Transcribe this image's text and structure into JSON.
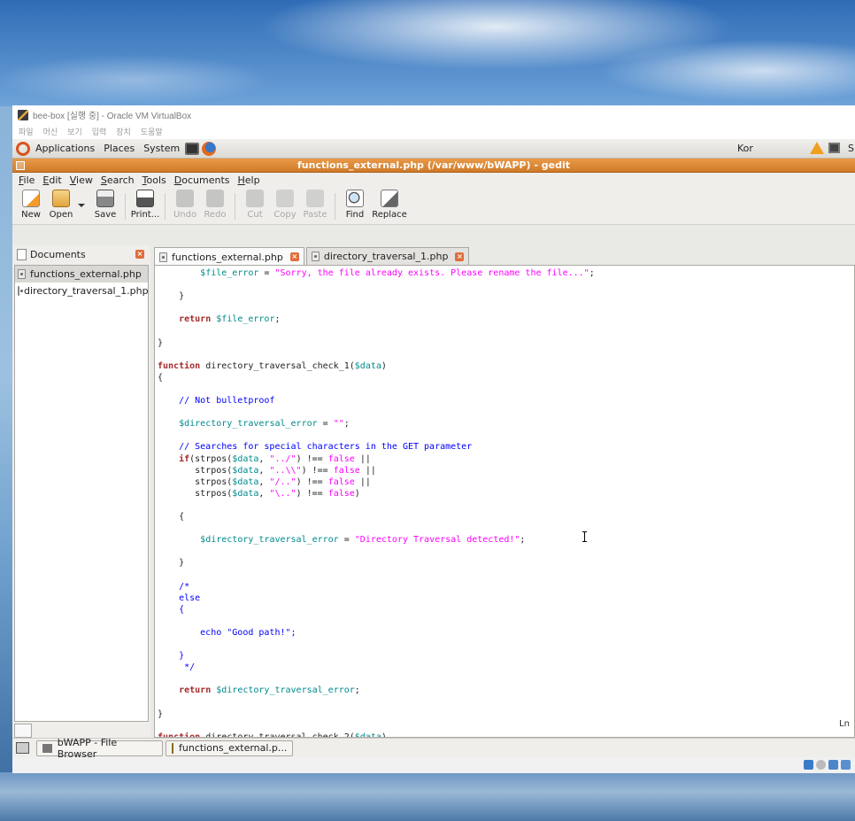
{
  "vbox": {
    "title": "bee-box [실행 중] - Oracle VM VirtualBox",
    "menu": [
      "파일",
      "머신",
      "보기",
      "입력",
      "장치",
      "도움말"
    ]
  },
  "gnome_panel": {
    "items": [
      "Applications",
      "Places",
      "System"
    ],
    "keyboard": "Kor",
    "right_label": "S"
  },
  "gedit": {
    "title": "functions_external.php (/var/www/bWAPP) - gedit",
    "menu": [
      "File",
      "Edit",
      "View",
      "Search",
      "Tools",
      "Documents",
      "Help"
    ],
    "toolbar": {
      "new": "New",
      "open": "Open",
      "save": "Save",
      "print": "Print...",
      "undo": "Undo",
      "redo": "Redo",
      "cut": "Cut",
      "copy": "Copy",
      "paste": "Paste",
      "find": "Find",
      "replace": "Replace"
    },
    "side_panel": {
      "title": "Documents",
      "items": [
        "functions_external.php",
        "directory_traversal_1.php"
      ]
    },
    "tabs": [
      "functions_external.php",
      "directory_traversal_1.php"
    ],
    "status": {
      "ln": "Ln"
    }
  },
  "taskbar": {
    "tasks": [
      "bWAPP - File Browser",
      "functions_external.p..."
    ]
  },
  "colors": {
    "gedit_title": "#e08a38",
    "keyword": "#a52a2a",
    "variable": "#008a8c",
    "string": "#ff00ff",
    "comment": "#0000ff"
  },
  "code_lines": [
    "        $file_error = \"Sorry, the file already exists. Please rename the file...\";",
    "",
    "    }",
    "",
    "    return $file_error;",
    "",
    "}",
    "",
    "function directory_traversal_check_1($data)",
    "{",
    "",
    "    // Not bulletproof",
    "",
    "    $directory_traversal_error = \"\";",
    "",
    "    // Searches for special characters in the GET parameter",
    "    if(strpos($data, \"../\") !== false ||",
    "       strpos($data, \"..\\\\\") !== false ||",
    "       strpos($data, \"/..\") !== false ||",
    "       strpos($data, \"\\..\") !== false)",
    "",
    "    {",
    "",
    "        $directory_traversal_error = \"Directory Traversal detected!\";",
    "",
    "    }",
    "",
    "    /*",
    "    else",
    "    {",
    "",
    "        echo \"Good path!\";",
    "",
    "    }",
    "     */",
    "",
    "    return $directory_traversal_error;",
    "",
    "}",
    "",
    "function directory_traversal_check_2($data)"
  ]
}
